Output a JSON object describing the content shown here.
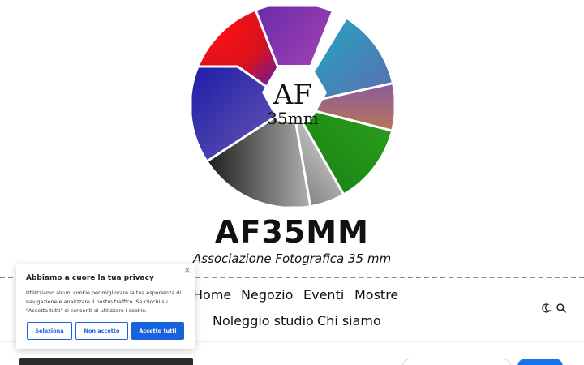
{
  "logo": {
    "line1": "AF",
    "line2": "35mm",
    "colors": [
      "#f00a14",
      "#8b2fb5",
      "#15a6bd",
      "#c4a12a",
      "#1b8a1b",
      "#8a8a8a",
      "#000000",
      "#1b1f9e"
    ]
  },
  "site": {
    "title": "AF35MM",
    "tagline": "Associazione Fotografica 35 mm"
  },
  "nav": {
    "items": [
      {
        "label": "Home"
      },
      {
        "label": "Negozio"
      },
      {
        "label": "Eventi"
      },
      {
        "label": "Mostre"
      },
      {
        "label": "Noleggio studio"
      },
      {
        "label": "Chi siamo"
      }
    ],
    "icons": [
      "moon-icon",
      "search-icon"
    ]
  },
  "cookie": {
    "close": "×",
    "title": "Abbiamo a cuore la tua privacy",
    "text": "Utilizziamo alcuni cookie per migliorare la tua esperienza di navigazione e analizzare il nostro traffico. Se clicchi su \"Accetta tutti\" ci consenti di utilizzare i cookie.",
    "buttons": {
      "select": "Seleziona",
      "reject": "Non accetto",
      "accept": "Accetto tutti"
    },
    "accent": "#1863dc"
  },
  "colors": {
    "search_button": "#1a73e8"
  }
}
